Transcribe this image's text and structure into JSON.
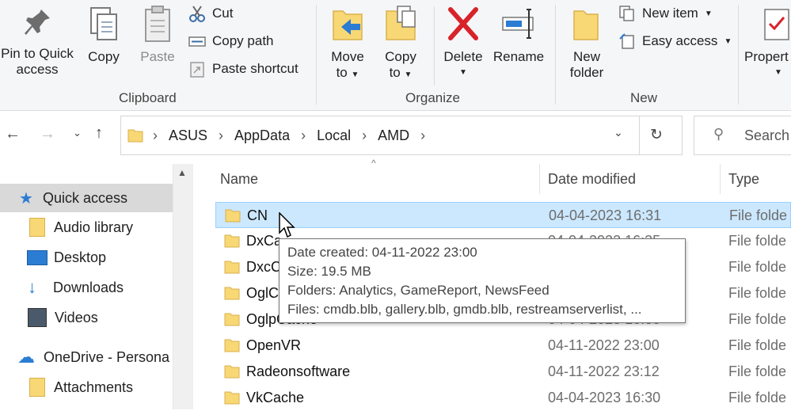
{
  "ribbon": {
    "pin_label_1": "Pin to Quick",
    "pin_label_2": "access",
    "copy_label": "Copy",
    "paste_label": "Paste",
    "cut_label": "Cut",
    "copy_path_label": "Copy path",
    "paste_shortcut_label": "Paste shortcut",
    "clipboard_group": "Clipboard",
    "move_label_1": "Move",
    "move_label_2": "to",
    "copyto_label_1": "Copy",
    "copyto_label_2": "to",
    "delete_label": "Delete",
    "rename_label": "Rename",
    "organize_group": "Organize",
    "new_folder_label_1": "New",
    "new_folder_label_2": "folder",
    "new_item_label": "New item",
    "easy_access_label": "Easy access",
    "new_group": "New",
    "properties_label": "Propert"
  },
  "address": {
    "crumbs": [
      "ASUS",
      "AppData",
      "Local",
      "AMD"
    ],
    "search_placeholder": "Search"
  },
  "nav": {
    "items": [
      {
        "label": "Quick access",
        "icon": "star-icon"
      },
      {
        "label": "Audio library",
        "icon": "folder-icon"
      },
      {
        "label": "Desktop",
        "icon": "desktop-icon"
      },
      {
        "label": "Downloads",
        "icon": "download-icon"
      },
      {
        "label": "Videos",
        "icon": "video-icon"
      },
      {
        "label": "OneDrive - Persona",
        "icon": "cloud-icon"
      },
      {
        "label": "Attachments",
        "icon": "folder-icon"
      }
    ]
  },
  "list": {
    "columns": {
      "name": "Name",
      "date": "Date modified",
      "type": "Type"
    },
    "rows": [
      {
        "name": "CN",
        "date": "04-04-2023 16:31",
        "type": "File folde"
      },
      {
        "name": "DxCa",
        "date": "04-04-2023 16:35",
        "type": "File folde"
      },
      {
        "name": "DxcC",
        "date": "",
        "type": "File folde"
      },
      {
        "name": "OglC",
        "date": "",
        "type": "File folde"
      },
      {
        "name": "OglpCache",
        "date": "04-04-2023 16:30",
        "type": "File folde"
      },
      {
        "name": "OpenVR",
        "date": "04-11-2022 23:00",
        "type": "File folde"
      },
      {
        "name": "Radeonsoftware",
        "date": "04-11-2022 23:12",
        "type": "File folde"
      },
      {
        "name": "VkCache",
        "date": "04-04-2023 16:30",
        "type": "File folde"
      }
    ]
  },
  "tooltip": {
    "line1": "Date created: 04-11-2022 23:00",
    "line2": "Size: 19.5 MB",
    "line3": "Folders: Analytics, GameReport, NewsFeed",
    "line4": "Files: cmdb.blb, gallery.blb, gmdb.blb, restreamserverlist, ..."
  },
  "colors": {
    "selection": "#cce8ff",
    "accent": "#0078d7",
    "folder": "#f8d775",
    "delete_red": "#d8232a"
  }
}
